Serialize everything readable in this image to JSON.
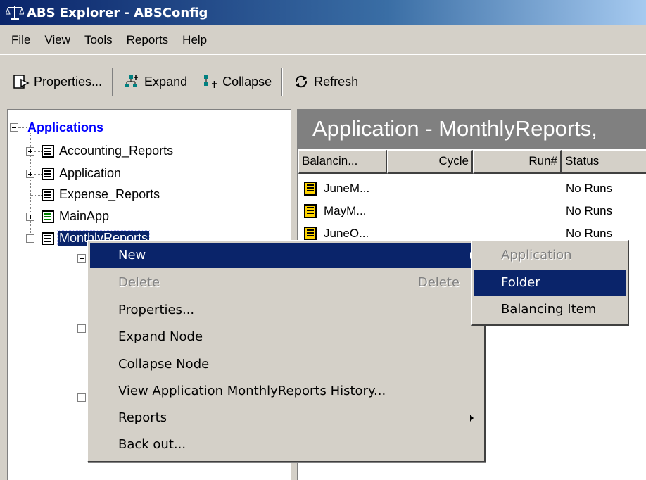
{
  "window": {
    "title": "ABS Explorer - ABSConfig",
    "icon": "scales-icon"
  },
  "menubar": [
    "File",
    "View",
    "Tools",
    "Reports",
    "Help"
  ],
  "toolbar": {
    "properties": "Properties...",
    "expand": "Expand",
    "collapse": "Collapse",
    "refresh": "Refresh"
  },
  "tree": {
    "root": "Applications",
    "items": [
      "Accounting_Reports",
      "Application",
      "Expense_Reports",
      "MainApp",
      "MonthlyReports"
    ],
    "root_color": "#0000ff"
  },
  "list": {
    "header": "Application - MonthlyReports,",
    "columns": [
      "Balancin...",
      "Cycle",
      "Run#",
      "Status"
    ],
    "rows": [
      {
        "name": "JuneM...",
        "cycle": "",
        "run": "",
        "status": "No Runs"
      },
      {
        "name": "MayM...",
        "cycle": "",
        "run": "",
        "status": "No Runs"
      },
      {
        "name": "JuneO...",
        "cycle": "",
        "run": "",
        "status": "No Runs"
      }
    ]
  },
  "context_menu": {
    "items": [
      "New",
      "Delete",
      "Properties...",
      "Expand Node",
      "Collapse Node",
      "View Application MonthlyReports History...",
      "Reports",
      "Back out..."
    ],
    "delete_accel": "Delete"
  },
  "submenu": {
    "items": [
      "Application",
      "Folder",
      "Balancing Item"
    ]
  },
  "colors": {
    "selection": "#0a246a",
    "title_start": "#0a246a",
    "title_end": "#a6caf0",
    "face": "#d4d0c8"
  }
}
